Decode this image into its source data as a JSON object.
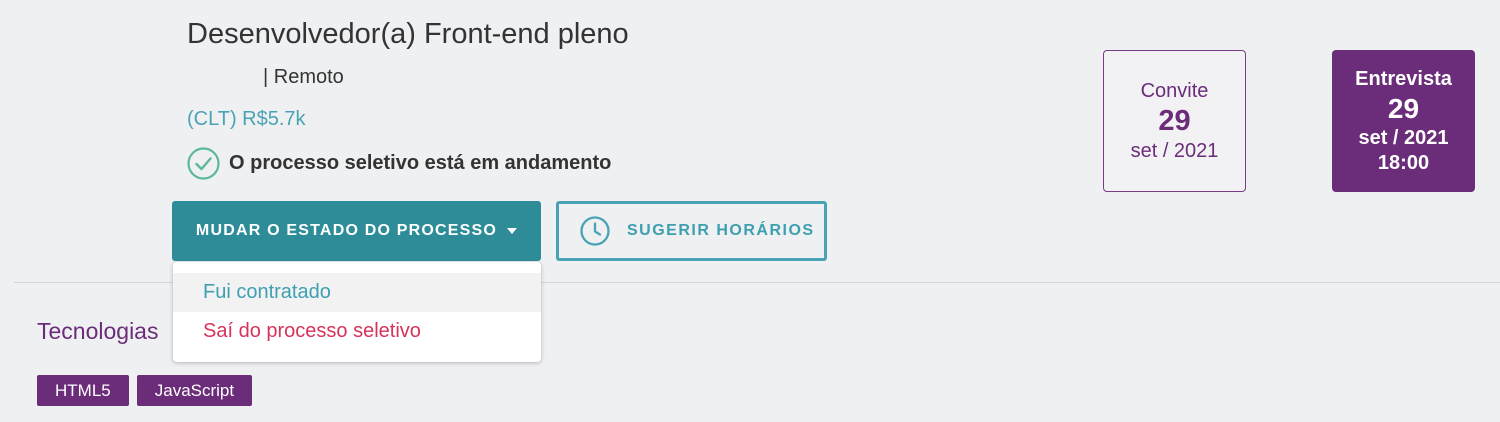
{
  "job": {
    "title": "Desenvolvedor(a) Front-end pleno",
    "location": "| Remoto",
    "salary": "(CLT) R$5.7k",
    "status": "O processo seletivo está em andamento"
  },
  "actions": {
    "change_state_label": "MUDAR O ESTADO DO PROCESSO",
    "suggest_times_label": "SUGERIR HORÁRIOS"
  },
  "dropdown": {
    "items": [
      {
        "label": "Fui contratado"
      },
      {
        "label": "Saí do processo seletivo"
      }
    ]
  },
  "invite_card": {
    "label": "Convite",
    "day": "29",
    "month_year": "set / 2021"
  },
  "interview_card": {
    "label": "Entrevista",
    "day": "29",
    "month_year": "set / 2021",
    "time": "18:00"
  },
  "technologies": {
    "heading": "Tecnologias",
    "tags": [
      "HTML5",
      "JavaScript"
    ]
  },
  "icons": {
    "status": "check-circle-icon",
    "suggest": "clock-icon",
    "dropdown": "caret-down-icon"
  },
  "colors": {
    "primary_teal": "#2e8c99",
    "brand_purple": "#6b2d7a",
    "danger": "#d6335a",
    "success": "#5bb89a"
  }
}
